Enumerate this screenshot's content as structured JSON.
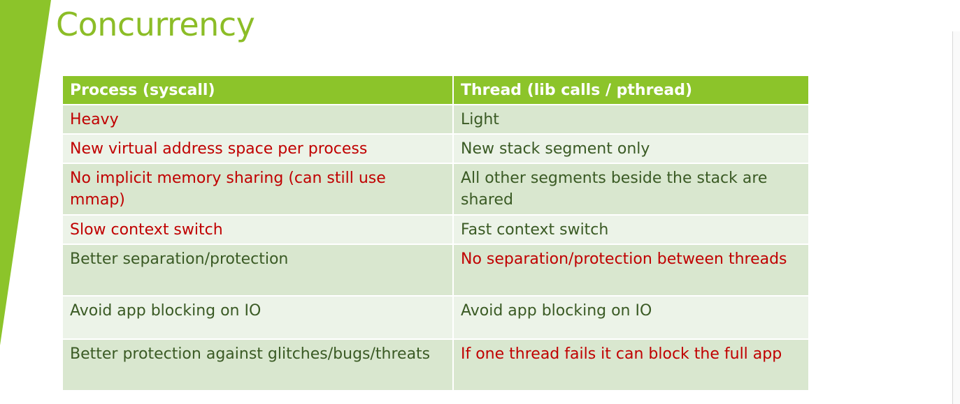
{
  "slide": {
    "title": "Concurrency",
    "colors": {
      "accent": "#8cbd27",
      "header_bg": "#8cc42a",
      "row_dark": "#d9e7cf",
      "row_light": "#ecf3e8",
      "negative_text": "#c00000",
      "positive_text": "#3a5a24"
    }
  },
  "table": {
    "headers": [
      "Process (syscall)",
      "Thread (lib calls / pthread)"
    ],
    "rows": [
      {
        "process": "Heavy",
        "thread": "Light"
      },
      {
        "process": "New virtual address space per process",
        "thread": "New stack segment only"
      },
      {
        "process": "No implicit memory sharing (can still use mmap)",
        "thread": "All other segments beside the stack are shared"
      },
      {
        "process": "Slow context switch",
        "thread": "Fast context switch"
      },
      {
        "process": "Better separation/protection",
        "thread": "No separation/protection between threads"
      },
      {
        "process": "Avoid app blocking on IO",
        "thread": "Avoid app blocking on IO"
      },
      {
        "process": "Better protection against glitches/bugs/threats",
        "thread": "If one thread fails it can block the full app"
      }
    ]
  }
}
